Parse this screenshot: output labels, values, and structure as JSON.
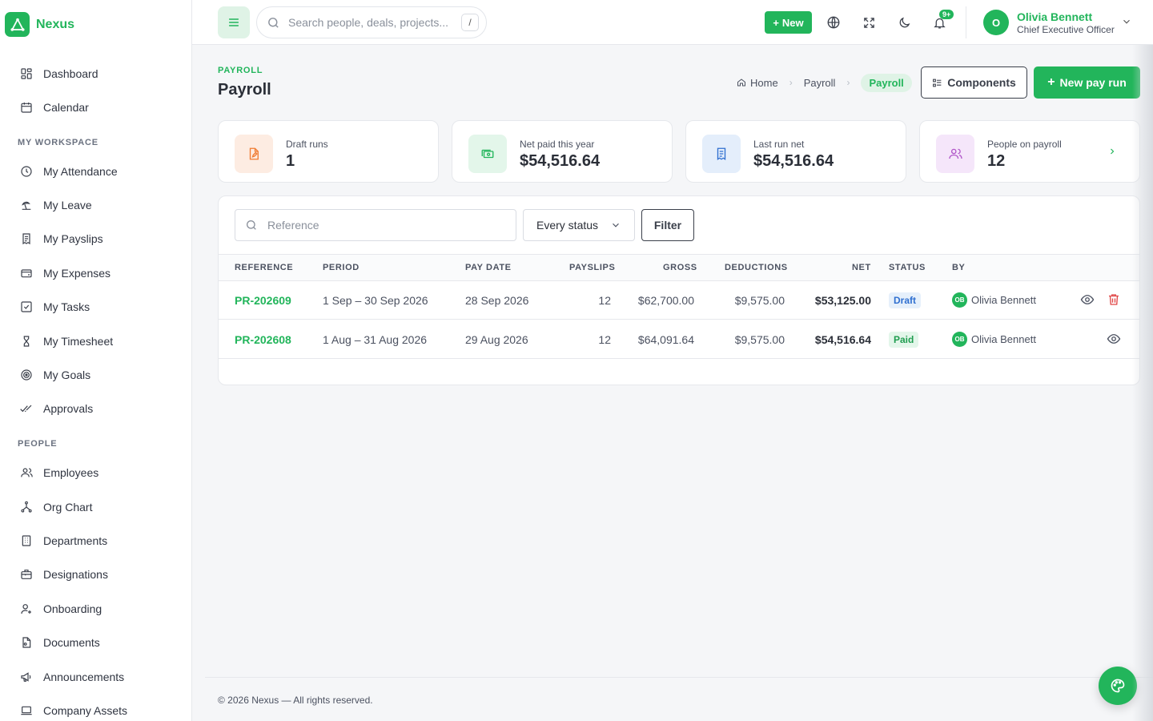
{
  "app": {
    "name": "Nexus"
  },
  "sidebar": {
    "items": [
      {
        "label": "Dashboard",
        "icon": "dashboard-icon"
      },
      {
        "label": "Calendar",
        "icon": "calendar-icon"
      }
    ],
    "sections": [
      {
        "title": "MY WORKSPACE",
        "items": [
          {
            "label": "My Attendance",
            "icon": "clock-icon"
          },
          {
            "label": "My Leave",
            "icon": "beach-icon"
          },
          {
            "label": "My Payslips",
            "icon": "receipt-icon"
          },
          {
            "label": "My Expenses",
            "icon": "wallet-icon"
          },
          {
            "label": "My Tasks",
            "icon": "checkbox-icon"
          },
          {
            "label": "My Timesheet",
            "icon": "hourglass-icon"
          },
          {
            "label": "My Goals",
            "icon": "target-icon"
          },
          {
            "label": "Approvals",
            "icon": "double-check-icon"
          }
        ]
      },
      {
        "title": "PEOPLE",
        "items": [
          {
            "label": "Employees",
            "icon": "users-icon"
          },
          {
            "label": "Org Chart",
            "icon": "org-chart-icon"
          },
          {
            "label": "Departments",
            "icon": "building-icon"
          },
          {
            "label": "Designations",
            "icon": "briefcase-icon"
          },
          {
            "label": "Onboarding",
            "icon": "user-plus-icon"
          },
          {
            "label": "Documents",
            "icon": "document-icon"
          },
          {
            "label": "Announcements",
            "icon": "megaphone-icon"
          },
          {
            "label": "Company Assets",
            "icon": "laptop-icon"
          }
        ]
      }
    ]
  },
  "header": {
    "search_placeholder": "Search people, deals, projects...",
    "search_shortcut": "/",
    "new_label": "New",
    "notifications_badge": "9+",
    "user": {
      "initial": "O",
      "name": "Olivia Bennett",
      "role": "Chief Executive Officer"
    }
  },
  "page": {
    "eyebrow": "PAYROLL",
    "title": "Payroll",
    "breadcrumb": [
      "Home",
      "Payroll",
      "Payroll"
    ],
    "components_label": "Components",
    "new_run_label": "New pay run"
  },
  "stats": [
    {
      "label": "Draft runs",
      "value": "1",
      "icon": "file-edit-icon",
      "color": "#f07c33",
      "bg": "#fdece2"
    },
    {
      "label": "Net paid this year",
      "value": "$54,516.64",
      "icon": "cash-icon",
      "color": "#22b55b",
      "bg": "#e3f6ea"
    },
    {
      "label": "Last run net",
      "value": "$54,516.64",
      "icon": "receipt-icon",
      "color": "#2f6fd0",
      "bg": "#e4eefb"
    },
    {
      "label": "People on payroll",
      "value": "12",
      "icon": "users-icon",
      "color": "#b055c8",
      "bg": "#f5e6fa"
    }
  ],
  "filters": {
    "reference_placeholder": "Reference",
    "status_value": "Every status",
    "filter_label": "Filter"
  },
  "table": {
    "columns": [
      "REFERENCE",
      "PERIOD",
      "PAY DATE",
      "PAYSLIPS",
      "GROSS",
      "DEDUCTIONS",
      "NET",
      "STATUS",
      "BY"
    ],
    "rows": [
      {
        "reference": "PR-202609",
        "period": "1 Sep – 30 Sep 2026",
        "pay_date": "28 Sep 2026",
        "payslips": "12",
        "gross": "$62,700.00",
        "deductions": "$9,575.00",
        "net": "$53,125.00",
        "status": "Draft",
        "by_initials": "OB",
        "by_name": "Olivia Bennett"
      },
      {
        "reference": "PR-202608",
        "period": "1 Aug – 31 Aug 2026",
        "pay_date": "29 Aug 2026",
        "payslips": "12",
        "gross": "$64,091.64",
        "deductions": "$9,575.00",
        "net": "$54,516.64",
        "status": "Paid",
        "by_initials": "OB",
        "by_name": "Olivia Bennett"
      }
    ]
  },
  "footer": {
    "text": "© 2026 Nexus — All rights reserved."
  },
  "theme": {
    "accent": "#22b55b",
    "danger": "#e04646"
  }
}
